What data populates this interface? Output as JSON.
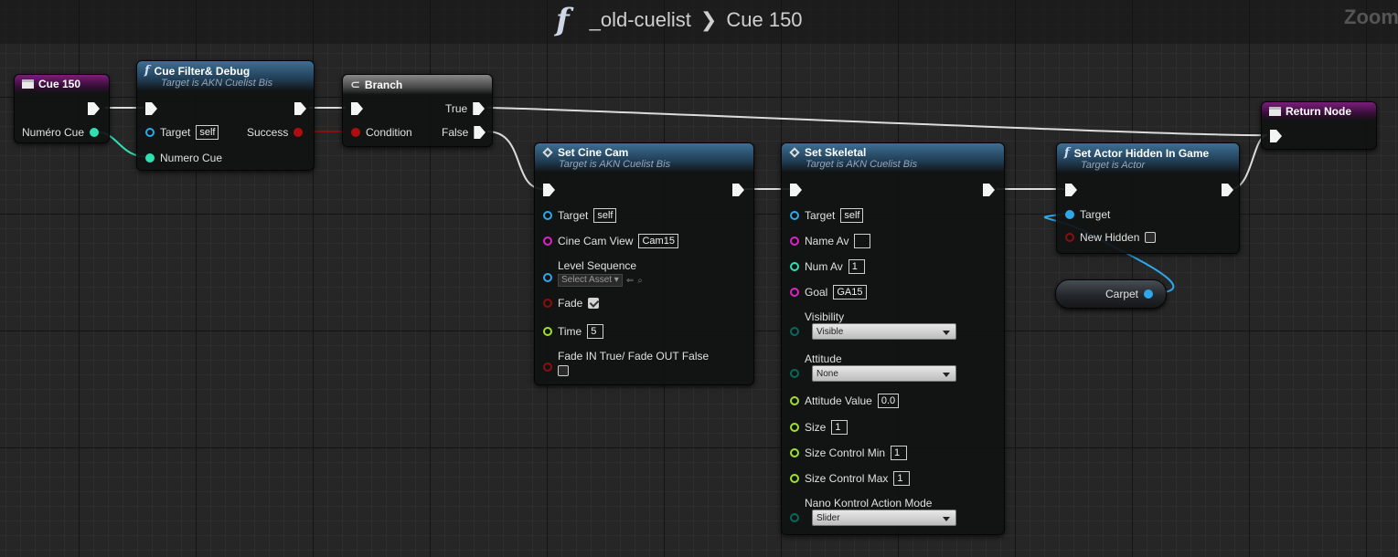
{
  "breadcrumb": {
    "function_symbol": "f",
    "parent": "_old-cuelist",
    "separator": "❯",
    "current": "Cue 150"
  },
  "zoom_label": "Zoom",
  "nodes": {
    "cue150": {
      "title": "Cue 150",
      "pin_label": "Numéro Cue"
    },
    "cue_filter": {
      "title": "Cue Filter& Debug",
      "subtitle": "Target is AKN Cuelist Bis",
      "target_label": "Target",
      "target_value": "self",
      "numero_label": "Numero Cue",
      "success_label": "Success"
    },
    "branch": {
      "title": "Branch",
      "condition_label": "Condition",
      "true_label": "True",
      "false_label": "False"
    },
    "return_node": {
      "title": "Return Node"
    },
    "set_cine_cam": {
      "title": "Set Cine Cam",
      "subtitle": "Target is AKN Cuelist Bis",
      "target_label": "Target",
      "target_value": "self",
      "cine_cam_view_label": "Cine Cam View",
      "cine_cam_view_value": "Cam15",
      "level_sequence_label": "Level Sequence",
      "level_sequence_value": "Select Asset",
      "fade_label": "Fade",
      "fade_checked": true,
      "time_label": "Time",
      "time_value": "5",
      "fade_in_label": "Fade IN True/ Fade OUT False",
      "fade_in_checked": false
    },
    "set_skeletal": {
      "title": "Set Skeletal",
      "subtitle": "Target is AKN Cuelist Bis",
      "target_label": "Target",
      "target_value": "self",
      "name_av_label": "Name Av",
      "name_av_value": "",
      "num_av_label": "Num Av",
      "num_av_value": "1",
      "goal_label": "Goal",
      "goal_value": "GA15",
      "visibility_label": "Visibility",
      "visibility_value": "Visible",
      "attitude_label": "Attitude",
      "attitude_value": "None",
      "attitude_value_label": "Attitude Value",
      "attitude_value_value": "0.0",
      "size_label": "Size",
      "size_value": "1",
      "size_min_label": "Size Control Min",
      "size_min_value": "1",
      "size_max_label": "Size Control Max",
      "size_max_value": "1",
      "nano_label": "Nano Kontrol Action Mode",
      "nano_value": "Slider"
    },
    "set_actor_hidden": {
      "title": "Set Actor Hidden In Game",
      "subtitle": "Target is Actor",
      "target_label": "Target",
      "new_hidden_label": "New Hidden",
      "new_hidden_checked": false
    },
    "carpet_var": {
      "label": "Carpet"
    }
  },
  "colors": {
    "exec": "#f4f4f4",
    "object": "#2ea8ea",
    "integer": "#2fe0b0",
    "boolean": "#b00e0e",
    "string": "#e020c8",
    "name": "#c060ff",
    "float": "#9fe030",
    "byte": "#066a5a",
    "event_header": "#7a1e7a",
    "function_header": "#3d6f93"
  }
}
